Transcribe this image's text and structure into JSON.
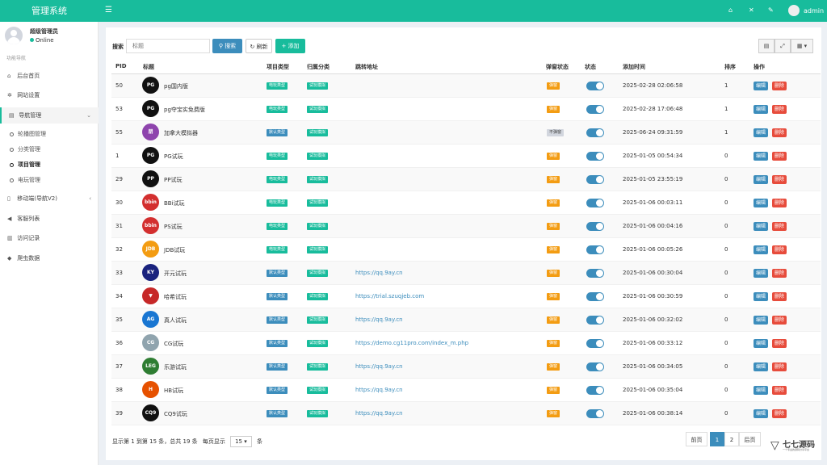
{
  "app": {
    "title": "管理系统",
    "user_name": "admin"
  },
  "sidebar": {
    "user": {
      "name": "超级管理员",
      "status": "Online"
    },
    "header": "功能导航",
    "items": [
      {
        "label": "后台首页",
        "icon": "home-icon"
      },
      {
        "label": "网站设置",
        "icon": "gears-icon"
      },
      {
        "label": "导航管理",
        "icon": "list-icon"
      },
      {
        "label": "移动端(导航V2)",
        "icon": "mobile-icon"
      },
      {
        "label": "客服列表",
        "icon": "bullhorn-icon"
      },
      {
        "label": "访问记录",
        "icon": "chart-icon"
      },
      {
        "label": "爬虫数据",
        "icon": "tag-icon"
      }
    ],
    "subitems": [
      {
        "label": "轮播图管理"
      },
      {
        "label": "分类管理"
      },
      {
        "label": "项目管理"
      },
      {
        "label": "电玩管理"
      }
    ]
  },
  "toolbar": {
    "search_label": "搜索",
    "search_placeholder": "标题",
    "search_button": "搜索",
    "refresh_button": "刷新",
    "add_button": "添加"
  },
  "table": {
    "headers": {
      "pid": "PID",
      "title": "标题",
      "type": "项目类型",
      "category": "归属分类",
      "url": "跳转地址",
      "popup": "弹窗状态",
      "status": "状态",
      "time": "添加时间",
      "sort": "排序",
      "action": "操作"
    },
    "edit_label": "编辑",
    "delete_label": "删除",
    "rows": [
      {
        "pid": "50",
        "title": "pg国内版",
        "type": "电玩类型",
        "category": "试玩模拟",
        "url": "",
        "popup": "弹窗",
        "time": "2025-02-28 02:06:58",
        "sort": "1",
        "logo_text": "PG",
        "logo_color": "#111111"
      },
      {
        "pid": "53",
        "title": "pg夺宝实免费版",
        "type": "电玩类型",
        "category": "试玩模拟",
        "url": "",
        "popup": "弹窗",
        "time": "2025-02-28 17:06:48",
        "sort": "1",
        "logo_text": "PG",
        "logo_color": "#111111"
      },
      {
        "pid": "55",
        "title": "加拿大模拟器",
        "type": "默认类型",
        "category": "试玩模拟",
        "url": "",
        "popup": "不弹窗",
        "time": "2025-06-24 09:31:59",
        "sort": "1",
        "logo_text": "朋",
        "logo_color": "#8e44ad"
      },
      {
        "pid": "1",
        "title": "PG试玩",
        "type": "电玩类型",
        "category": "试玩模拟",
        "url": "",
        "popup": "弹窗",
        "time": "2025-01-05 00:54:34",
        "sort": "0",
        "logo_text": "PG",
        "logo_color": "#111111"
      },
      {
        "pid": "29",
        "title": "PP试玩",
        "type": "电玩类型",
        "category": "试玩模拟",
        "url": "",
        "popup": "弹窗",
        "time": "2025-01-05 23:55:19",
        "sort": "0",
        "logo_text": "PP",
        "logo_color": "#111111"
      },
      {
        "pid": "30",
        "title": "BBi试玩",
        "type": "电玩类型",
        "category": "试玩模拟",
        "url": "",
        "popup": "弹窗",
        "time": "2025-01-06 00:03:11",
        "sort": "0",
        "logo_text": "bbin",
        "logo_color": "#d32f2f"
      },
      {
        "pid": "31",
        "title": "PS试玩",
        "type": "电玩类型",
        "category": "试玩模拟",
        "url": "",
        "popup": "弹窗",
        "time": "2025-01-06 00:04:16",
        "sort": "0",
        "logo_text": "bbin",
        "logo_color": "#d32f2f"
      },
      {
        "pid": "32",
        "title": "JDB试玩",
        "type": "电玩类型",
        "category": "试玩模拟",
        "url": "",
        "popup": "弹窗",
        "time": "2025-01-06 00:05:26",
        "sort": "0",
        "logo_text": "JDB",
        "logo_color": "#f39c12"
      },
      {
        "pid": "33",
        "title": "开元试玩",
        "type": "默认类型",
        "category": "试玩模拟",
        "url": "https://qq.9ay.cn",
        "popup": "弹窗",
        "time": "2025-01-06 00:30:04",
        "sort": "0",
        "logo_text": "KY",
        "logo_color": "#1a237e"
      },
      {
        "pid": "34",
        "title": "哈希试玩",
        "type": "默认类型",
        "category": "试玩模拟",
        "url": "https://trial.szuqjeb.com",
        "popup": "弹窗",
        "time": "2025-01-06 00:30:59",
        "sort": "0",
        "logo_text": "▼",
        "logo_color": "#c62828"
      },
      {
        "pid": "35",
        "title": "真人试玩",
        "type": "默认类型",
        "category": "试玩模拟",
        "url": "https://qq.9ay.cn",
        "popup": "弹窗",
        "time": "2025-01-06 00:32:02",
        "sort": "0",
        "logo_text": "AG",
        "logo_color": "#1976d2"
      },
      {
        "pid": "36",
        "title": "CG试玩",
        "type": "默认类型",
        "category": "试玩模拟",
        "url": "https://demo.cg11pro.com/index_m.php",
        "popup": "弹窗",
        "time": "2025-01-06 00:33:12",
        "sort": "0",
        "logo_text": "CG",
        "logo_color": "#90a4ae"
      },
      {
        "pid": "37",
        "title": "乐游试玩",
        "type": "默认类型",
        "category": "试玩模拟",
        "url": "https://qq.9ay.cn",
        "popup": "弹窗",
        "time": "2025-01-06 00:34:05",
        "sort": "0",
        "logo_text": "LEG",
        "logo_color": "#2e7d32"
      },
      {
        "pid": "38",
        "title": "HB试玩",
        "type": "默认类型",
        "category": "试玩模拟",
        "url": "https://qq.9ay.cn",
        "popup": "弹窗",
        "time": "2025-01-06 00:35:04",
        "sort": "0",
        "logo_text": "H",
        "logo_color": "#e65100"
      },
      {
        "pid": "39",
        "title": "CQ9试玩",
        "type": "默认类型",
        "category": "试玩模拟",
        "url": "https://qq.9ay.cn",
        "popup": "弹窗",
        "time": "2025-01-06 00:38:14",
        "sort": "0",
        "logo_text": "CQ9",
        "logo_color": "#111111"
      }
    ]
  },
  "footer": {
    "summary": "显示第 1 到第 15 条，总共 19 条",
    "per_page_prefix": "每页显示",
    "per_page_value": "15",
    "per_page_suffix": "条",
    "pagination": [
      "前页",
      "1",
      "2",
      "后页"
    ]
  },
  "watermark": {
    "title": "七七源码",
    "subtitle": "一个专业的源码分享平台"
  },
  "colors": {
    "brand": "#18bc9c",
    "primary": "#3c8dbc",
    "danger": "#e74c3c",
    "warning": "#f39c12"
  }
}
